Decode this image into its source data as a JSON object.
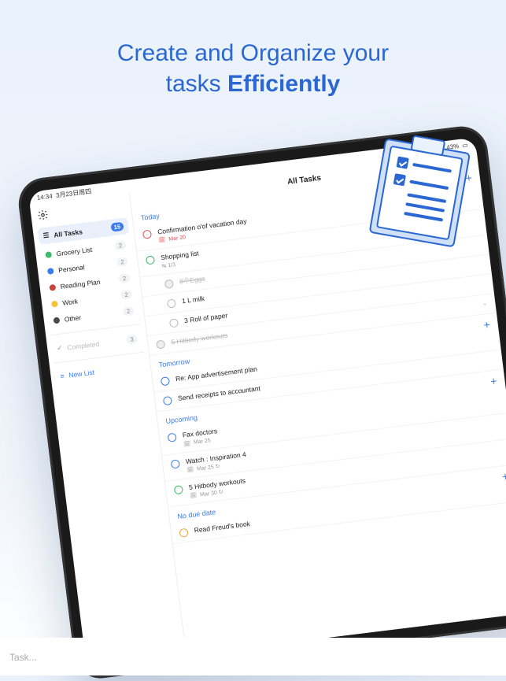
{
  "headline": {
    "l1": "Create and Organize your",
    "l2a": "tasks ",
    "l2b": "Efficiently"
  },
  "statusbar": {
    "time": "14:34",
    "date": "3月23日周四",
    "battery": "43%"
  },
  "sidebar": {
    "all": {
      "label": "All Tasks",
      "count": "15"
    },
    "lists": [
      {
        "label": "Grocery List",
        "count": "2",
        "color": "#3dbb6a"
      },
      {
        "label": "Personal",
        "count": "2",
        "color": "#3a7bf0"
      },
      {
        "label": "Reading Plan",
        "count": "2",
        "color": "#c9433a"
      },
      {
        "label": "Work",
        "count": "2",
        "color": "#f2c23a"
      },
      {
        "label": "Other",
        "count": "2",
        "color": "#4a4a4a"
      }
    ],
    "completed": {
      "label": "Completed",
      "count": "3"
    },
    "new": "New List"
  },
  "main": {
    "title": "All Tasks",
    "groups": {
      "today": {
        "label": "Today",
        "tasks": [
          {
            "title": "Confirmation o'of vacation day",
            "meta": "Mar 20",
            "ring": "red",
            "metaRed": true
          },
          {
            "title": "Shopping list",
            "meta": "⇆ 1/3",
            "ring": "green"
          }
        ],
        "subs": [
          {
            "title": "8个Eggs",
            "done": true
          },
          {
            "title": "1 L milk"
          },
          {
            "title": "3 Roll of paper"
          }
        ],
        "doneTask": {
          "title": "5 Hitbody workouts"
        }
      },
      "tomorrow": {
        "label": "Tomorrow",
        "tasks": [
          {
            "title": "Re: App advertisement plan",
            "ring": "blue"
          },
          {
            "title": "Send receipts to accountant",
            "ring": "blue"
          }
        ]
      },
      "upcoming": {
        "label": "Upcoming",
        "tasks": [
          {
            "title": "Fax doctors",
            "meta": "Mar 25",
            "ring": "blue"
          },
          {
            "title": "Watch : Inspiration 4",
            "meta": "Mar 25 ↻",
            "ring": "blue"
          },
          {
            "title": "5 Hitbody workouts",
            "meta": "Mar 30 ↻",
            "ring": "green"
          }
        ]
      },
      "nodue": {
        "label": "No due date",
        "tasks": [
          {
            "title": "Read Freud's book",
            "ring": "orange"
          }
        ]
      }
    }
  },
  "input": {
    "placeholder": "Task..."
  }
}
